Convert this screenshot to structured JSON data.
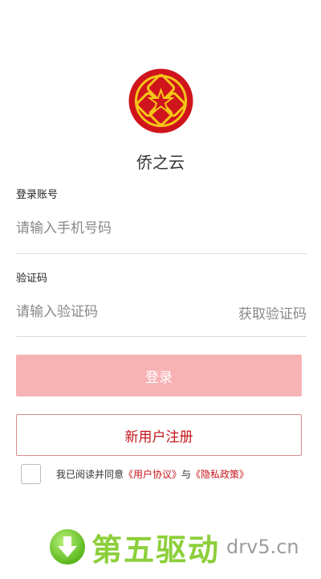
{
  "app": {
    "name": "侨之云"
  },
  "account": {
    "label": "登录账号",
    "placeholder": "请输入手机号码",
    "value": ""
  },
  "code": {
    "label": "验证码",
    "placeholder": "请输入验证码",
    "value": "",
    "get_code_label": "获取验证码"
  },
  "buttons": {
    "login": "登录",
    "register": "新用户注册"
  },
  "agreement": {
    "checked": false,
    "prefix": "我已阅读并同意",
    "user_agreement": "《用户协议》",
    "joiner": "与",
    "privacy_policy": "《隐私政策》"
  },
  "watermark": {
    "text": "第五驱动",
    "url": "drv5.cn",
    "icon": "download-arrow-icon"
  },
  "colors": {
    "brand_red": "#c4161c",
    "login_disabled": "#f7b2b4",
    "logo_gold": "#f5c518"
  }
}
